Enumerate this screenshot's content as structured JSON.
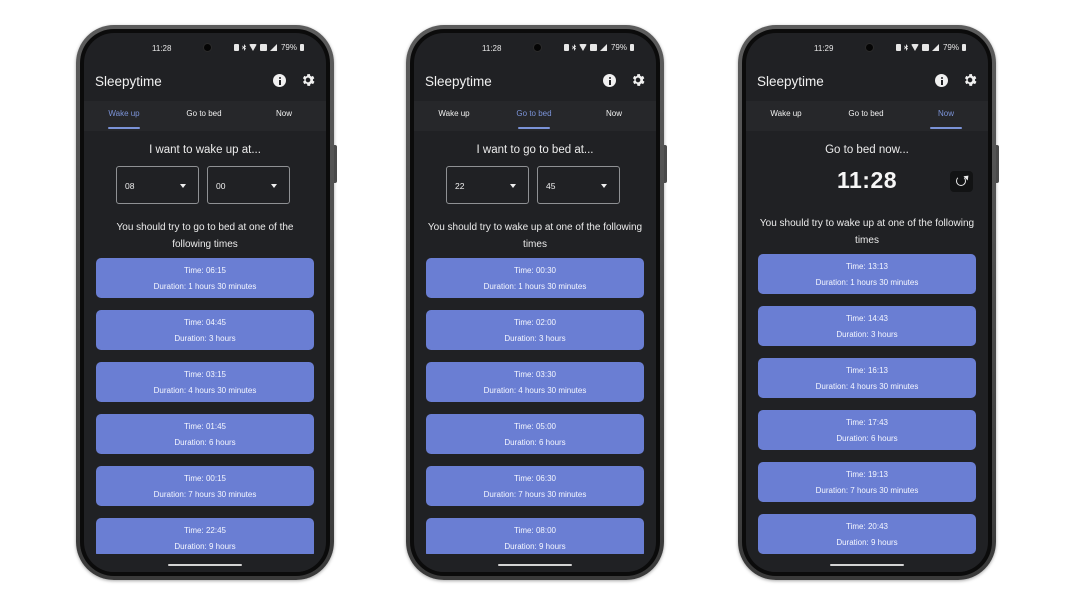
{
  "app_title": "Sleepytime",
  "tabs": [
    "Wake up",
    "Go to bed",
    "Now"
  ],
  "phones": [
    {
      "status_time": "11:28",
      "battery": "79%",
      "active_tab": "Wake up",
      "prompt": "I want to wake up at...",
      "hour": "08",
      "minute": "00",
      "suggestion": "You should try to go to bed at one of the following times",
      "cards": [
        {
          "time": "Time: 06:15",
          "duration": "Duration: 1 hours 30 minutes"
        },
        {
          "time": "Time: 04:45",
          "duration": "Duration: 3 hours"
        },
        {
          "time": "Time: 03:15",
          "duration": "Duration: 4 hours 30 minutes"
        },
        {
          "time": "Time: 01:45",
          "duration": "Duration: 6 hours"
        },
        {
          "time": "Time: 00:15",
          "duration": "Duration: 7 hours 30 minutes"
        },
        {
          "time": "Time: 22:45",
          "duration": "Duration: 9 hours"
        }
      ]
    },
    {
      "status_time": "11:28",
      "battery": "79%",
      "active_tab": "Go to bed",
      "prompt": "I want to go to bed at...",
      "hour": "22",
      "minute": "45",
      "suggestion": "You should try to wake up at one of the following times",
      "cards": [
        {
          "time": "Time: 00:30",
          "duration": "Duration: 1 hours 30 minutes"
        },
        {
          "time": "Time: 02:00",
          "duration": "Duration: 3 hours"
        },
        {
          "time": "Time: 03:30",
          "duration": "Duration: 4 hours 30 minutes"
        },
        {
          "time": "Time: 05:00",
          "duration": "Duration: 6 hours"
        },
        {
          "time": "Time: 06:30",
          "duration": "Duration: 7 hours 30 minutes"
        },
        {
          "time": "Time: 08:00",
          "duration": "Duration: 9 hours"
        }
      ]
    },
    {
      "status_time": "11:29",
      "battery": "79%",
      "active_tab": "Now",
      "prompt": "Go to bed now...",
      "now_time": "11:28",
      "suggestion": "You should try to wake up at one of the following times",
      "cards": [
        {
          "time": "Time: 13:13",
          "duration": "Duration: 1 hours 30 minutes"
        },
        {
          "time": "Time: 14:43",
          "duration": "Duration: 3 hours"
        },
        {
          "time": "Time: 16:13",
          "duration": "Duration: 4 hours 30 minutes"
        },
        {
          "time": "Time: 17:43",
          "duration": "Duration: 6 hours"
        },
        {
          "time": "Time: 19:13",
          "duration": "Duration: 7 hours 30 minutes"
        },
        {
          "time": "Time: 20:43",
          "duration": "Duration: 9 hours"
        }
      ]
    }
  ],
  "colors": {
    "accent": "#7b93d8",
    "card": "#6a7ed3",
    "background": "#202124",
    "tabbar": "#26272a"
  },
  "icons": {
    "status": [
      "vibrate-icon",
      "bluetooth-icon",
      "wifi-icon",
      "nfc-icon",
      "signal-icon",
      "battery-icon"
    ],
    "appbar": [
      "info-icon",
      "gear-icon"
    ],
    "now": "refresh-icon"
  }
}
